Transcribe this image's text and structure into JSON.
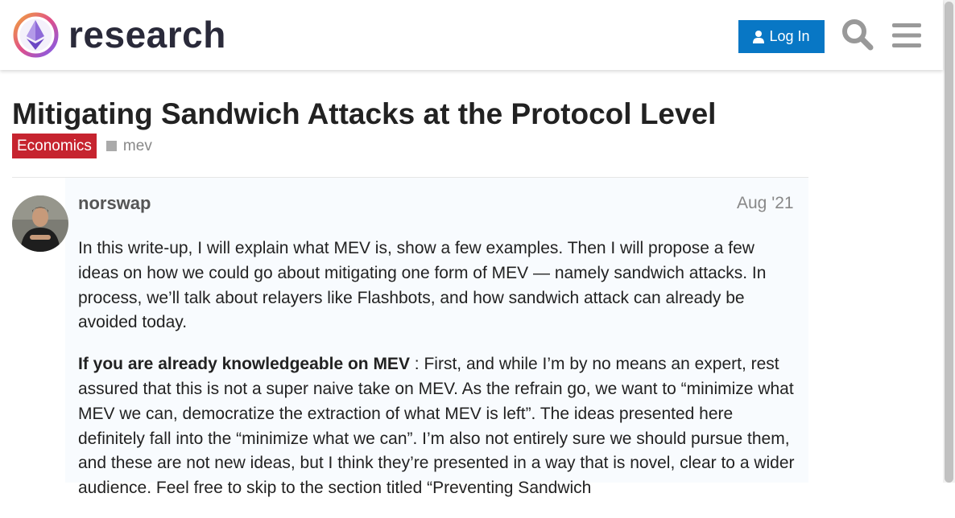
{
  "header": {
    "site_name": "research",
    "login_label": "Log In"
  },
  "topic": {
    "title": "Mitigating Sandwich Attacks at the Protocol Level",
    "category": "Economics",
    "tag": "mev"
  },
  "post": {
    "author": "norswap",
    "date": "Aug '21",
    "paragraph1": "In this write-up, I will explain what MEV is, show a few examples. Then I will propose a few ideas on how we could go about mitigating one form of MEV — namely sandwich attacks. In process, we’ll talk about relayers like Flashbots, and how sandwich attack can already be avoided today.",
    "paragraph2_bold": "If you are already knowledgeable on MEV",
    "paragraph2_rest": " : First, and while I’m by no means an expert, rest assured that this is not a super naive take on MEV. As the refrain go, we want to “minimize what MEV we can, democratize the extraction of what MEV is left”. The ideas presented here definitely fall into the “minimize what we can”. I’m also not entirely sure we should pursue them, and these are not new ideas, but I think they’re presented in a way that is novel, clear to a wider audience. Feel free to skip to the section titled “Preventing Sandwich"
  },
  "colors": {
    "login_bg": "#0877c5",
    "category_bg": "#c6242f",
    "post_bg": "#f8fbfe"
  },
  "icons": {
    "logo": "ethereum-research-logo",
    "login": "user-icon",
    "search": "search-icon",
    "menu": "hamburger-menu-icon"
  }
}
